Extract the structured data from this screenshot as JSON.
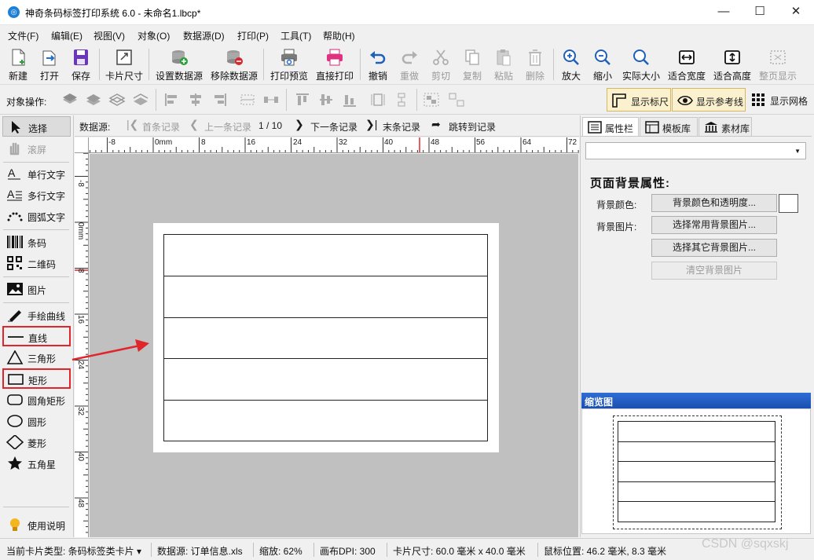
{
  "window": {
    "title": "神奇条码标签打印系统 6.0 - 未命名1.lbcp*",
    "app_icon": "app-logo-icon",
    "controls": [
      "minimize-icon",
      "maximize-icon",
      "close-icon"
    ]
  },
  "menu": [
    "文件(F)",
    "编辑(E)",
    "视图(V)",
    "对象(O)",
    "数据源(D)",
    "打印(P)",
    "工具(T)",
    "帮助(H)"
  ],
  "toolbar": {
    "new": "新建",
    "open": "打开",
    "save": "保存",
    "card_size": "卡片尺寸",
    "set_datasource": "设置数据源",
    "remove_datasource": "移除数据源",
    "print_preview": "打印预览",
    "direct_print": "直接打印",
    "undo": "撤销",
    "redo": "重做",
    "cut": "剪切",
    "copy": "复制",
    "paste": "粘贴",
    "delete": "删除",
    "zoom_in": "放大",
    "zoom_out": "缩小",
    "actual_size": "实际大小",
    "fit_width": "适合宽度",
    "fit_height": "适合高度",
    "fit_page": "整页显示"
  },
  "objbar": {
    "label": "对象操作:",
    "show_ruler": "显示标尺",
    "show_guides": "显示参考线",
    "show_grid": "显示网格"
  },
  "toolbox": {
    "select": "选择",
    "scroll": "滚屏",
    "single_text": "单行文字",
    "multi_text": "多行文字",
    "arc_text": "圆弧文字",
    "barcode": "条码",
    "qrcode": "二维码",
    "image": "图片",
    "freehand": "手绘曲线",
    "line": "直线",
    "triangle": "三角形",
    "rect": "矩形",
    "round_rect": "圆角矩形",
    "ellipse": "圆形",
    "diamond": "菱形",
    "star": "五角星",
    "help": "使用说明"
  },
  "navbar": {
    "label": "数据源:",
    "first": "首条记录",
    "prev": "上一条记录",
    "counter": "1 / 10",
    "next": "下一条记录",
    "last": "末条记录",
    "jump": "跳转到记录"
  },
  "rulers": {
    "h_labels": [
      "-8",
      "0mm",
      "8",
      "16",
      "24",
      "32",
      "40",
      "48",
      "56",
      "64",
      "72"
    ],
    "v_labels": [
      "-8",
      "0mm",
      "8",
      "16",
      "24",
      "32",
      "40",
      "48"
    ]
  },
  "right_panel": {
    "tabs": [
      "属性栏",
      "模板库",
      "素材库"
    ],
    "section_title": "页面背景属性:",
    "bg_color_label": "背景颜色:",
    "bg_color_button": "背景颜色和透明度...",
    "bg_image_label": "背景图片:",
    "common_image_button": "选择常用背景图片...",
    "other_image_button": "选择其它背景图片...",
    "clear_image_button": "清空背景图片",
    "overview_title": "缩览图"
  },
  "status": {
    "card_type": "当前卡片类型: 条码标签类卡片 ▾",
    "datasource": "数据源: 订单信息.xls",
    "zoom": "缩放: 62%",
    "dpi": "画布DPI: 300",
    "card_size": "卡片尺寸: 60.0 毫米 x 40.0 毫米",
    "mouse_pos": "鼠标位置: 46.2 毫米, 8.3 毫米"
  },
  "watermark": "CSDN @sqxskj",
  "colors": {
    "annotation_red": "#e0252b",
    "overview_header": "#1f56c0",
    "canvas_gray": "#c0c0c0"
  }
}
